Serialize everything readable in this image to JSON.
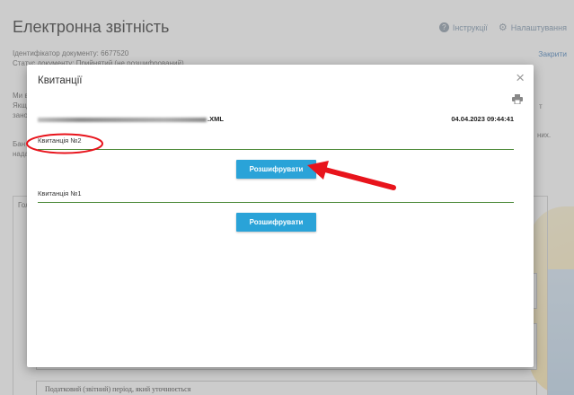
{
  "page": {
    "title": "Електронна звітність",
    "instructions_label": "Інструкції",
    "settings_label": "Налаштування",
    "doc_id_line": "Ідентифікатор документу: 6677520",
    "status_line": "Статус документу: Прийнятий  (не розшифрований)",
    "close_label": "Закрити",
    "bg_text_1": "Ми в",
    "bg_text_2": "Якщ",
    "bg_text_3": "зано",
    "bg_text_4": "Бан",
    "bg_text_5": "нада",
    "bg_text_right_1": "т",
    "bg_text_right_2": "них.",
    "bg_tab_label": "Гол",
    "bg_row_text": "Податковий (звітний) період, який уточнюється"
  },
  "modal": {
    "title": "Квитанції",
    "file_suffix": ".XML",
    "file_date": "04.04.2023 09:44:41",
    "receipts": [
      {
        "label": "Квитанція №2",
        "button": "Розшифрувати"
      },
      {
        "label": "Квитанція №1",
        "button": "Розшифрувати"
      }
    ]
  },
  "colors": {
    "button": "#2aa3d8",
    "section_line": "#4d8a3a",
    "annotation": "#e8141c"
  }
}
